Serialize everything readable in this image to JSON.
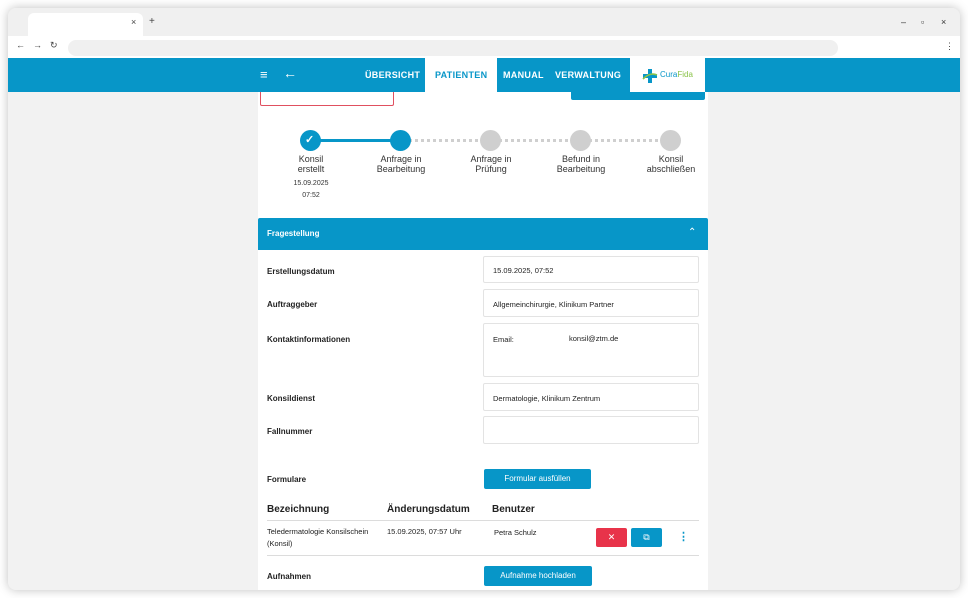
{
  "browser": {
    "tab_close": "×",
    "tab_new": "+",
    "nav_back": "←",
    "nav_forward": "→",
    "nav_reload": "↻",
    "win_min": "–",
    "win_max": "▫",
    "win_close": "×",
    "menu": "⋮"
  },
  "header": {
    "menu_icon": "≡",
    "back_icon": "←",
    "nav": [
      {
        "label": "ÜBERSICHT",
        "active": false
      },
      {
        "label": "PATIENTEN",
        "active": true
      },
      {
        "label": "MANUAL",
        "active": false
      },
      {
        "label": "VERWALTUNG",
        "active": false
      }
    ],
    "logo": {
      "part1": "Cura",
      "part2": "Fida"
    },
    "brand_color": "#0796c8"
  },
  "stepper": {
    "steps": [
      {
        "label_line1": "Konsil",
        "label_line2": "erstellt",
        "state": "done",
        "date": "15.09.2025",
        "time": "07:52"
      },
      {
        "label_line1": "Anfrage in",
        "label_line2": "Bearbeitung",
        "state": "current"
      },
      {
        "label_line1": "Anfrage in",
        "label_line2": "Prüfung",
        "state": "pending"
      },
      {
        "label_line1": "Befund in",
        "label_line2": "Bearbeitung",
        "state": "pending"
      },
      {
        "label_line1": "Konsil",
        "label_line2": "abschließen",
        "state": "pending"
      }
    ]
  },
  "panel": {
    "title": "Fragestellung",
    "chevron": "⌃",
    "fields": {
      "erstellungsdatum": {
        "label": "Erstellungsdatum",
        "value": "15.09.2025, 07:52"
      },
      "auftraggeber": {
        "label": "Auftraggeber",
        "value": "Allgemeinchirurgie, Klinikum Partner"
      },
      "kontakt": {
        "label": "Kontaktinformationen",
        "email_label": "Email:",
        "email_value": "konsil@ztm.de"
      },
      "konsildienst": {
        "label": "Konsildienst",
        "value": "Dermatologie, Klinikum Zentrum"
      },
      "fallnummer": {
        "label": "Fallnummer",
        "value": ""
      }
    },
    "formulare": {
      "label": "Formulare",
      "button": "Formular ausfüllen",
      "columns": [
        "Bezeichnung",
        "Änderungsdatum",
        "Benutzer"
      ],
      "rows": [
        {
          "name_line1": "Teledermatologie Konsilschein",
          "name_line2": "(Konsil)",
          "date": "15.09.2025, 07:57 Uhr",
          "user": "Petra Schulz",
          "delete": "✕",
          "open": "⧉",
          "more": "⋮"
        }
      ]
    },
    "aufnahmen": {
      "label": "Aufnahmen",
      "button": "Aufnahme hochladen"
    }
  }
}
